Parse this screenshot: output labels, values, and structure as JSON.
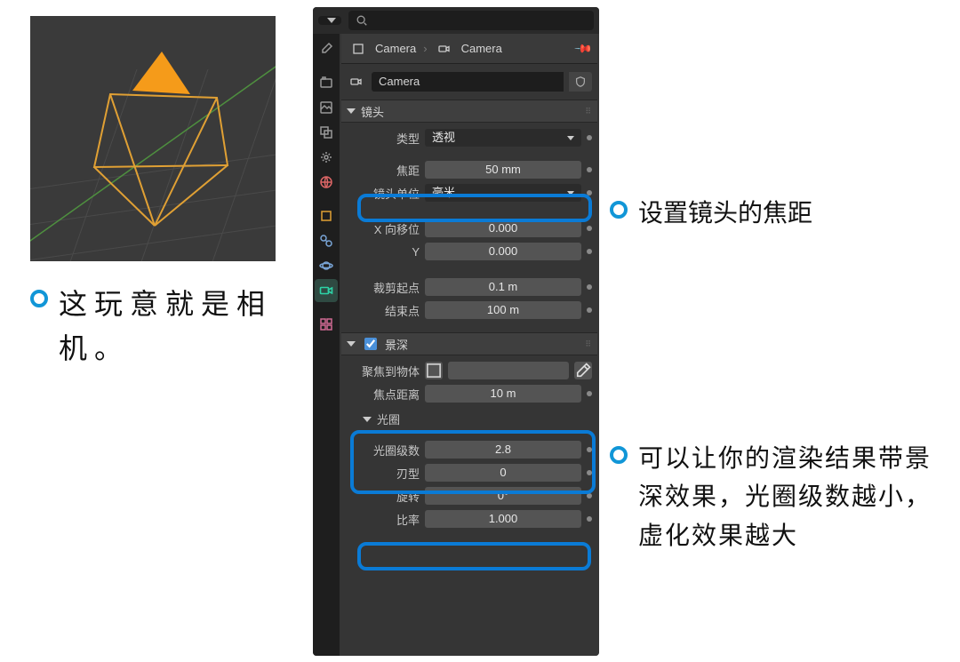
{
  "annotations": {
    "left": "这玩意就是相机。",
    "r1": "设置镜头的焦距",
    "r2": "可以让你的渲染结果带景深效果，光圈级数越小，虚化效果越大"
  },
  "breadcrumb": {
    "a": "Camera",
    "b": "Camera"
  },
  "datablock": {
    "name": "Camera"
  },
  "sections": {
    "lens": {
      "title": "镜头"
    },
    "dof": {
      "title": "景深"
    },
    "aperture": {
      "title": "光圈"
    }
  },
  "lens": {
    "type_label": "类型",
    "type_value": "透视",
    "focal_label": "焦距",
    "focal_value": "50 mm",
    "unit_label": "镜头单位",
    "unit_value": "毫米",
    "shiftx_label": "X 向移位",
    "shiftx_value": "0.000",
    "shifty_label": "Y",
    "shifty_value": "0.000",
    "clipstart_label": "裁剪起点",
    "clipstart_value": "0.1 m",
    "clipend_label": "结束点",
    "clipend_value": "100 m"
  },
  "dof": {
    "focusobj_label": "聚焦到物体",
    "focusdist_label": "焦点距离",
    "focusdist_value": "10 m"
  },
  "aperture": {
    "fstop_label": "光圈级数",
    "fstop_value": "2.8",
    "blades_label": "刃型",
    "blades_value": "0",
    "rotation_label": "旋转",
    "rotation_value": "0°",
    "ratio_label": "比率",
    "ratio_value": "1.000"
  },
  "icons": {
    "search": "search-icon",
    "camera": "camera-icon"
  }
}
